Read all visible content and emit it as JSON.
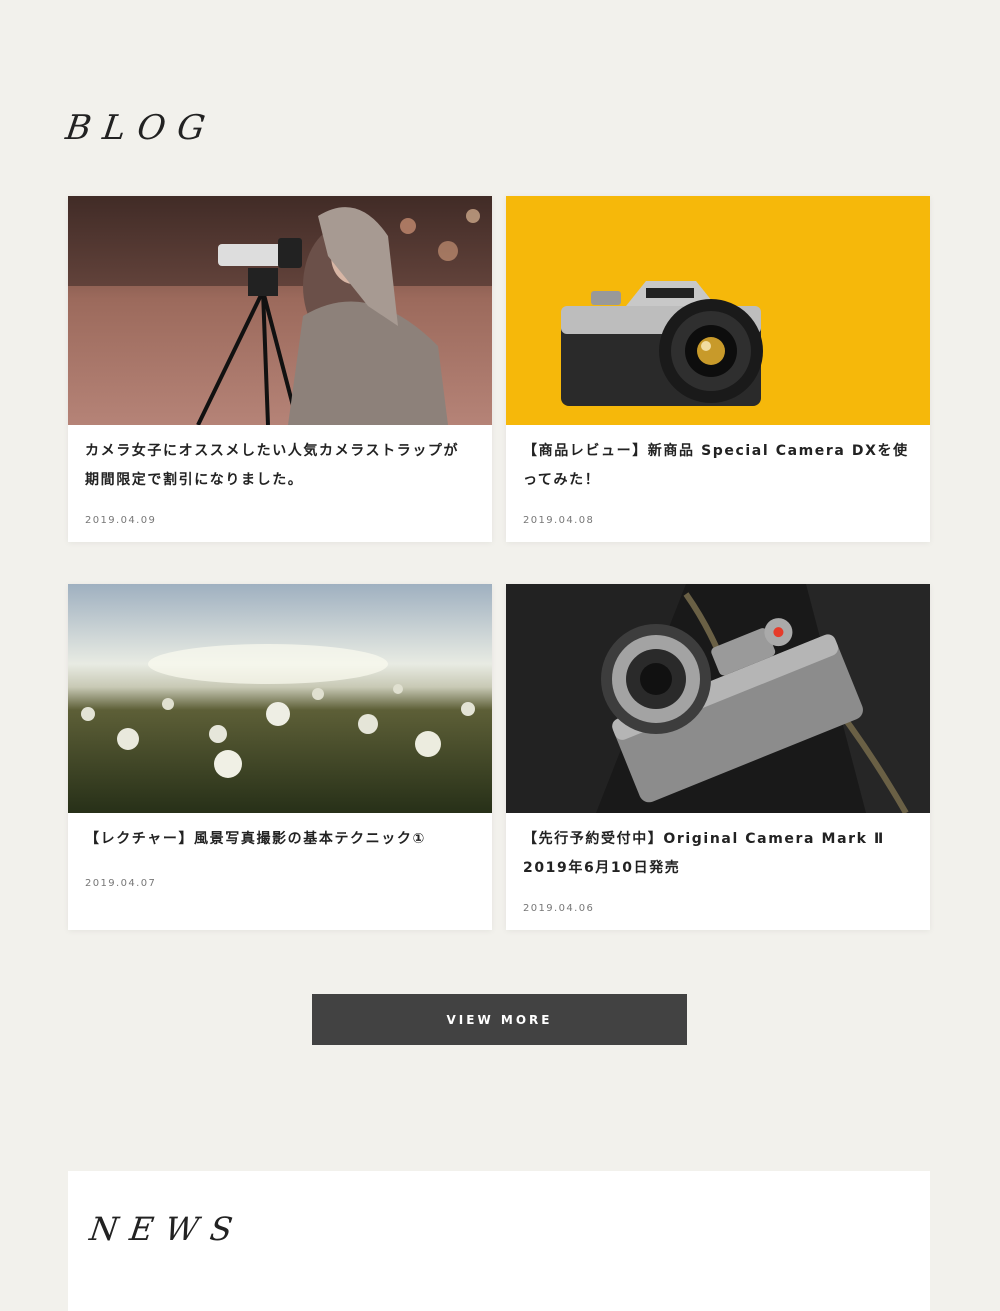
{
  "blog": {
    "heading": "BLOG",
    "posts": [
      {
        "title": "カメラ女子にオススメしたい人気カメラストラップが期間限定で割引になりました。",
        "date": "2019.04.09"
      },
      {
        "title": "【商品レビュー】新商品 Special Camera DXを使ってみた！",
        "date": "2019.04.08"
      },
      {
        "title": "【レクチャー】風景写真撮影の基本テクニック①",
        "date": "2019.04.07"
      },
      {
        "title": "【先行予約受付中】Original Camera Mark Ⅱ 2019年6月10日発売",
        "date": "2019.04.06"
      }
    ],
    "view_more": "VIEW MORE"
  },
  "news": {
    "heading": "NEWS"
  },
  "colors": {
    "background": "#f2f1ec",
    "button": "#424242",
    "card": "#ffffff",
    "yellow": "#f6b80a"
  }
}
